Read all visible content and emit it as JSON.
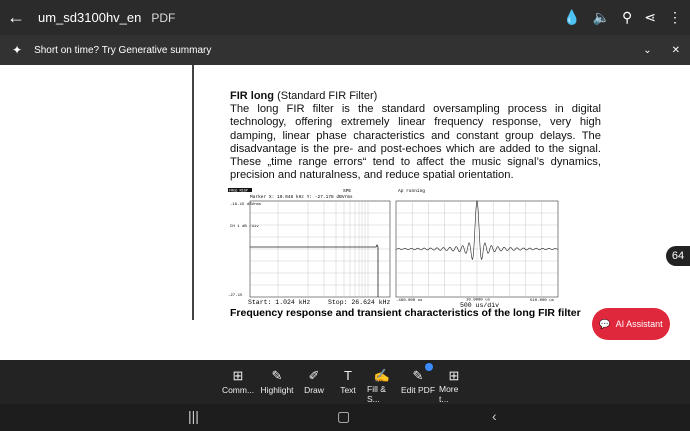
{
  "topbar": {
    "title": "um_sd3100hv_en",
    "type": "PDF"
  },
  "summary": {
    "text": "Short on time? Try Generative summary"
  },
  "doc": {
    "heading": "FIR long",
    "heading_sub": "(Standard FIR Filter)",
    "body": "The long FIR filter is the standard oversampling process in digital technology, offering extremely linear frequency response, very high damping, linear phase characteristics and constant group delays. The disadvantage is the pre- and post-echoes which are added to the signal. These „time range errors“ tend to affect the music signal’s dynamics, precision and naturalness, and reduce spatial orientation.",
    "caption": "Frequency response and transient characteristics of the long FIR filter",
    "fig1": {
      "tag": "FREQ RESP",
      "top": "SPE",
      "marker": "Marker X: 10.048 kHz    Y: -27.178 dBVrms",
      "ytop": "-19.15 dBVrms",
      "yscale": "CH 1 dB /div",
      "ybot": "-27.15",
      "start": "Start: 1.024 kHz",
      "stop": "Stop: 26.624 kHz"
    },
    "fig2": {
      "top": "Ap  running",
      "xl": "-490.000 us",
      "xm": "10.0000 us",
      "xdiv": "500  us/div",
      "xr": "510.000 us"
    }
  },
  "page_number": "64",
  "ai_button": "AI Assistant",
  "toolbar": [
    "Comm...",
    "Highlight",
    "Draw",
    "Text",
    "Fill & S...",
    "Edit PDF",
    "More t..."
  ]
}
